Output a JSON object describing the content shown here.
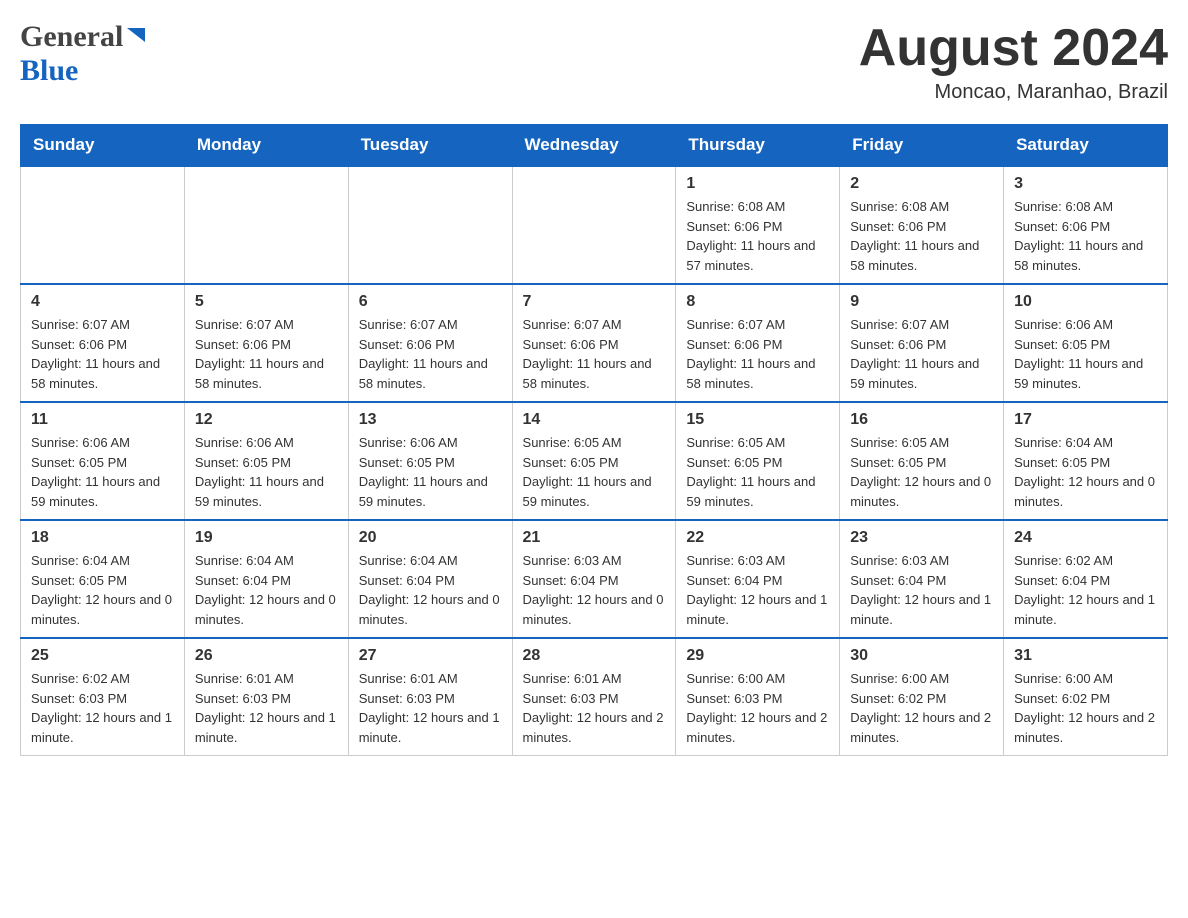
{
  "header": {
    "logo_general": "General",
    "logo_blue": "Blue",
    "month_title": "August 2024",
    "location": "Moncao, Maranhao, Brazil"
  },
  "days_of_week": [
    "Sunday",
    "Monday",
    "Tuesday",
    "Wednesday",
    "Thursday",
    "Friday",
    "Saturday"
  ],
  "weeks": [
    [
      {
        "day": "",
        "info": ""
      },
      {
        "day": "",
        "info": ""
      },
      {
        "day": "",
        "info": ""
      },
      {
        "day": "",
        "info": ""
      },
      {
        "day": "1",
        "info": "Sunrise: 6:08 AM\nSunset: 6:06 PM\nDaylight: 11 hours and 57 minutes."
      },
      {
        "day": "2",
        "info": "Sunrise: 6:08 AM\nSunset: 6:06 PM\nDaylight: 11 hours and 58 minutes."
      },
      {
        "day": "3",
        "info": "Sunrise: 6:08 AM\nSunset: 6:06 PM\nDaylight: 11 hours and 58 minutes."
      }
    ],
    [
      {
        "day": "4",
        "info": "Sunrise: 6:07 AM\nSunset: 6:06 PM\nDaylight: 11 hours and 58 minutes."
      },
      {
        "day": "5",
        "info": "Sunrise: 6:07 AM\nSunset: 6:06 PM\nDaylight: 11 hours and 58 minutes."
      },
      {
        "day": "6",
        "info": "Sunrise: 6:07 AM\nSunset: 6:06 PM\nDaylight: 11 hours and 58 minutes."
      },
      {
        "day": "7",
        "info": "Sunrise: 6:07 AM\nSunset: 6:06 PM\nDaylight: 11 hours and 58 minutes."
      },
      {
        "day": "8",
        "info": "Sunrise: 6:07 AM\nSunset: 6:06 PM\nDaylight: 11 hours and 58 minutes."
      },
      {
        "day": "9",
        "info": "Sunrise: 6:07 AM\nSunset: 6:06 PM\nDaylight: 11 hours and 59 minutes."
      },
      {
        "day": "10",
        "info": "Sunrise: 6:06 AM\nSunset: 6:05 PM\nDaylight: 11 hours and 59 minutes."
      }
    ],
    [
      {
        "day": "11",
        "info": "Sunrise: 6:06 AM\nSunset: 6:05 PM\nDaylight: 11 hours and 59 minutes."
      },
      {
        "day": "12",
        "info": "Sunrise: 6:06 AM\nSunset: 6:05 PM\nDaylight: 11 hours and 59 minutes."
      },
      {
        "day": "13",
        "info": "Sunrise: 6:06 AM\nSunset: 6:05 PM\nDaylight: 11 hours and 59 minutes."
      },
      {
        "day": "14",
        "info": "Sunrise: 6:05 AM\nSunset: 6:05 PM\nDaylight: 11 hours and 59 minutes."
      },
      {
        "day": "15",
        "info": "Sunrise: 6:05 AM\nSunset: 6:05 PM\nDaylight: 11 hours and 59 minutes."
      },
      {
        "day": "16",
        "info": "Sunrise: 6:05 AM\nSunset: 6:05 PM\nDaylight: 12 hours and 0 minutes."
      },
      {
        "day": "17",
        "info": "Sunrise: 6:04 AM\nSunset: 6:05 PM\nDaylight: 12 hours and 0 minutes."
      }
    ],
    [
      {
        "day": "18",
        "info": "Sunrise: 6:04 AM\nSunset: 6:05 PM\nDaylight: 12 hours and 0 minutes."
      },
      {
        "day": "19",
        "info": "Sunrise: 6:04 AM\nSunset: 6:04 PM\nDaylight: 12 hours and 0 minutes."
      },
      {
        "day": "20",
        "info": "Sunrise: 6:04 AM\nSunset: 6:04 PM\nDaylight: 12 hours and 0 minutes."
      },
      {
        "day": "21",
        "info": "Sunrise: 6:03 AM\nSunset: 6:04 PM\nDaylight: 12 hours and 0 minutes."
      },
      {
        "day": "22",
        "info": "Sunrise: 6:03 AM\nSunset: 6:04 PM\nDaylight: 12 hours and 1 minute."
      },
      {
        "day": "23",
        "info": "Sunrise: 6:03 AM\nSunset: 6:04 PM\nDaylight: 12 hours and 1 minute."
      },
      {
        "day": "24",
        "info": "Sunrise: 6:02 AM\nSunset: 6:04 PM\nDaylight: 12 hours and 1 minute."
      }
    ],
    [
      {
        "day": "25",
        "info": "Sunrise: 6:02 AM\nSunset: 6:03 PM\nDaylight: 12 hours and 1 minute."
      },
      {
        "day": "26",
        "info": "Sunrise: 6:01 AM\nSunset: 6:03 PM\nDaylight: 12 hours and 1 minute."
      },
      {
        "day": "27",
        "info": "Sunrise: 6:01 AM\nSunset: 6:03 PM\nDaylight: 12 hours and 1 minute."
      },
      {
        "day": "28",
        "info": "Sunrise: 6:01 AM\nSunset: 6:03 PM\nDaylight: 12 hours and 2 minutes."
      },
      {
        "day": "29",
        "info": "Sunrise: 6:00 AM\nSunset: 6:03 PM\nDaylight: 12 hours and 2 minutes."
      },
      {
        "day": "30",
        "info": "Sunrise: 6:00 AM\nSunset: 6:02 PM\nDaylight: 12 hours and 2 minutes."
      },
      {
        "day": "31",
        "info": "Sunrise: 6:00 AM\nSunset: 6:02 PM\nDaylight: 12 hours and 2 minutes."
      }
    ]
  ]
}
